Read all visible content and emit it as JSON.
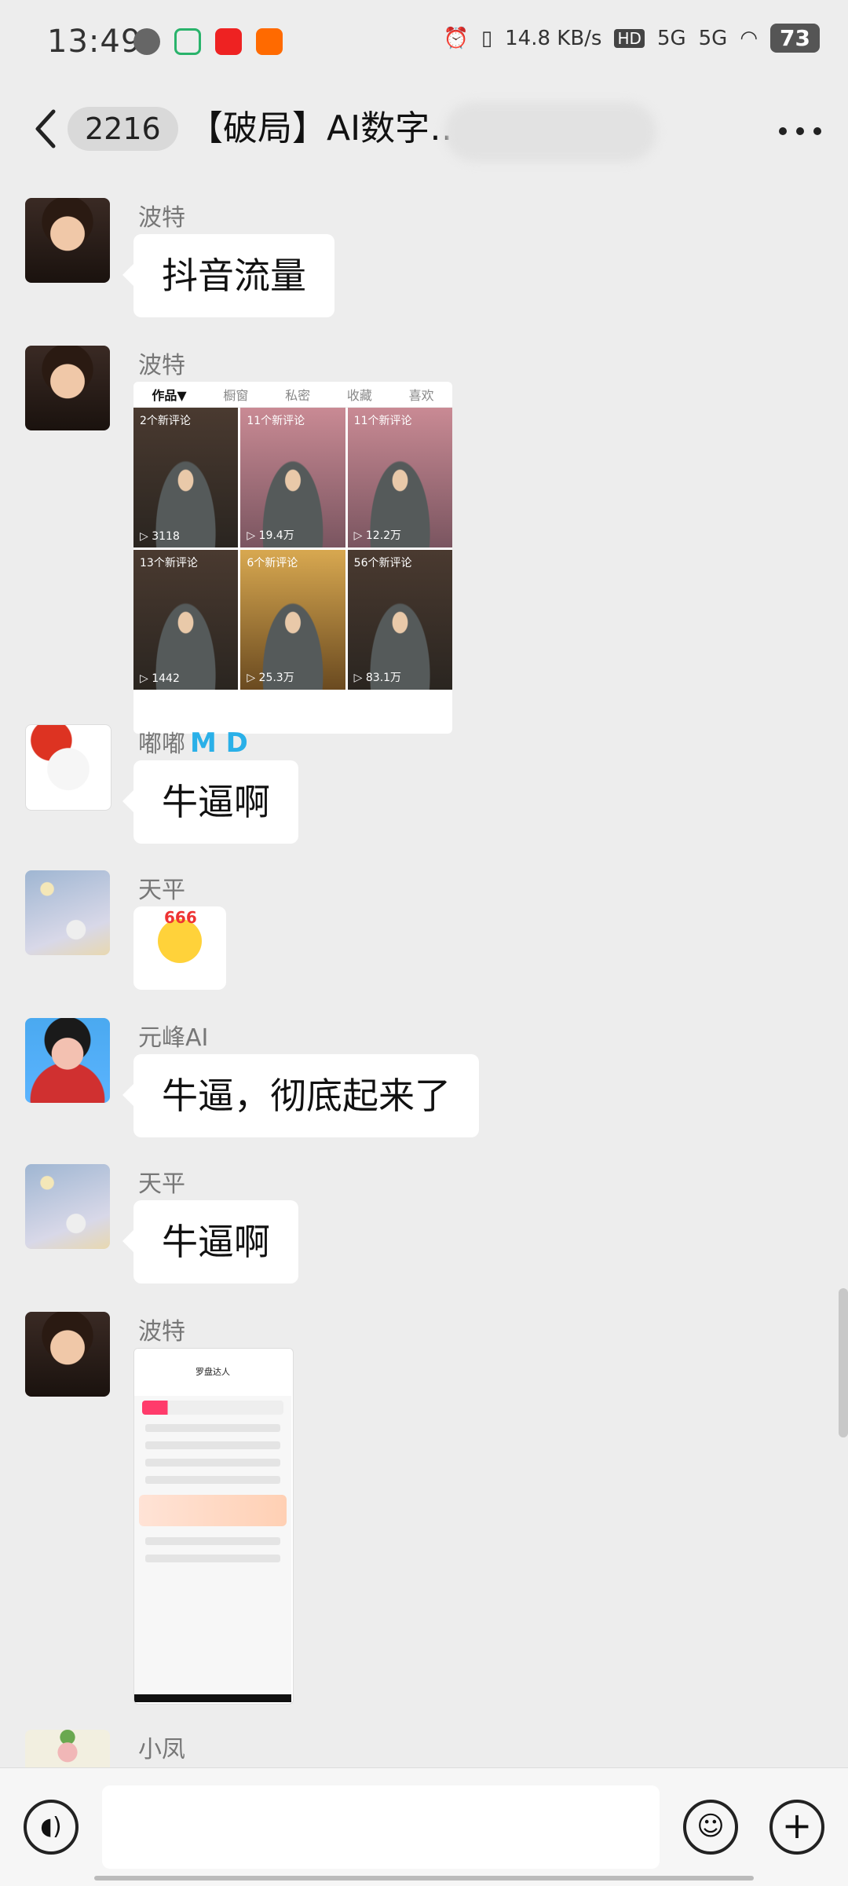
{
  "status": {
    "time": "13:49",
    "net_speed": "14.8 KB/s",
    "hd": "HD",
    "signal1": "5G",
    "signal2": "5G",
    "battery": "73"
  },
  "header": {
    "unread_count": "2216",
    "title": "【破局】AI数字…"
  },
  "messages": [
    {
      "sender": "波特",
      "type": "text",
      "text": "抖音流量"
    },
    {
      "sender": "波特",
      "type": "image_grid",
      "tabs": [
        "作品▼",
        "橱窗",
        "私密",
        "收藏",
        "喜欢"
      ],
      "cells": [
        {
          "top": "2个新评论",
          "bottom": "▷ 3118"
        },
        {
          "top": "11个新评论",
          "bottom": "▷ 19.4万"
        },
        {
          "top": "11个新评论",
          "bottom": "▷ 12.2万"
        },
        {
          "top": "13个新评论",
          "bottom": "▷ 1442"
        },
        {
          "top": "6个新评论",
          "bottom": "▷ 25.3万"
        },
        {
          "top": "56个新评论",
          "bottom": "▷ 83.1万"
        }
      ]
    },
    {
      "sender": "嘟嘟",
      "sender_tag": "M D",
      "type": "text",
      "text": "牛逼啊"
    },
    {
      "sender": "天平",
      "type": "sticker",
      "text": ""
    },
    {
      "sender": "元峰AI",
      "type": "text",
      "text": "牛逼，彻底起来了"
    },
    {
      "sender": "天平",
      "type": "text",
      "text": "牛逼啊"
    },
    {
      "sender": "波特",
      "type": "image_screenshot",
      "screen_title": "罗盘达人"
    },
    {
      "sender": "小凤",
      "type": "partial"
    }
  ]
}
